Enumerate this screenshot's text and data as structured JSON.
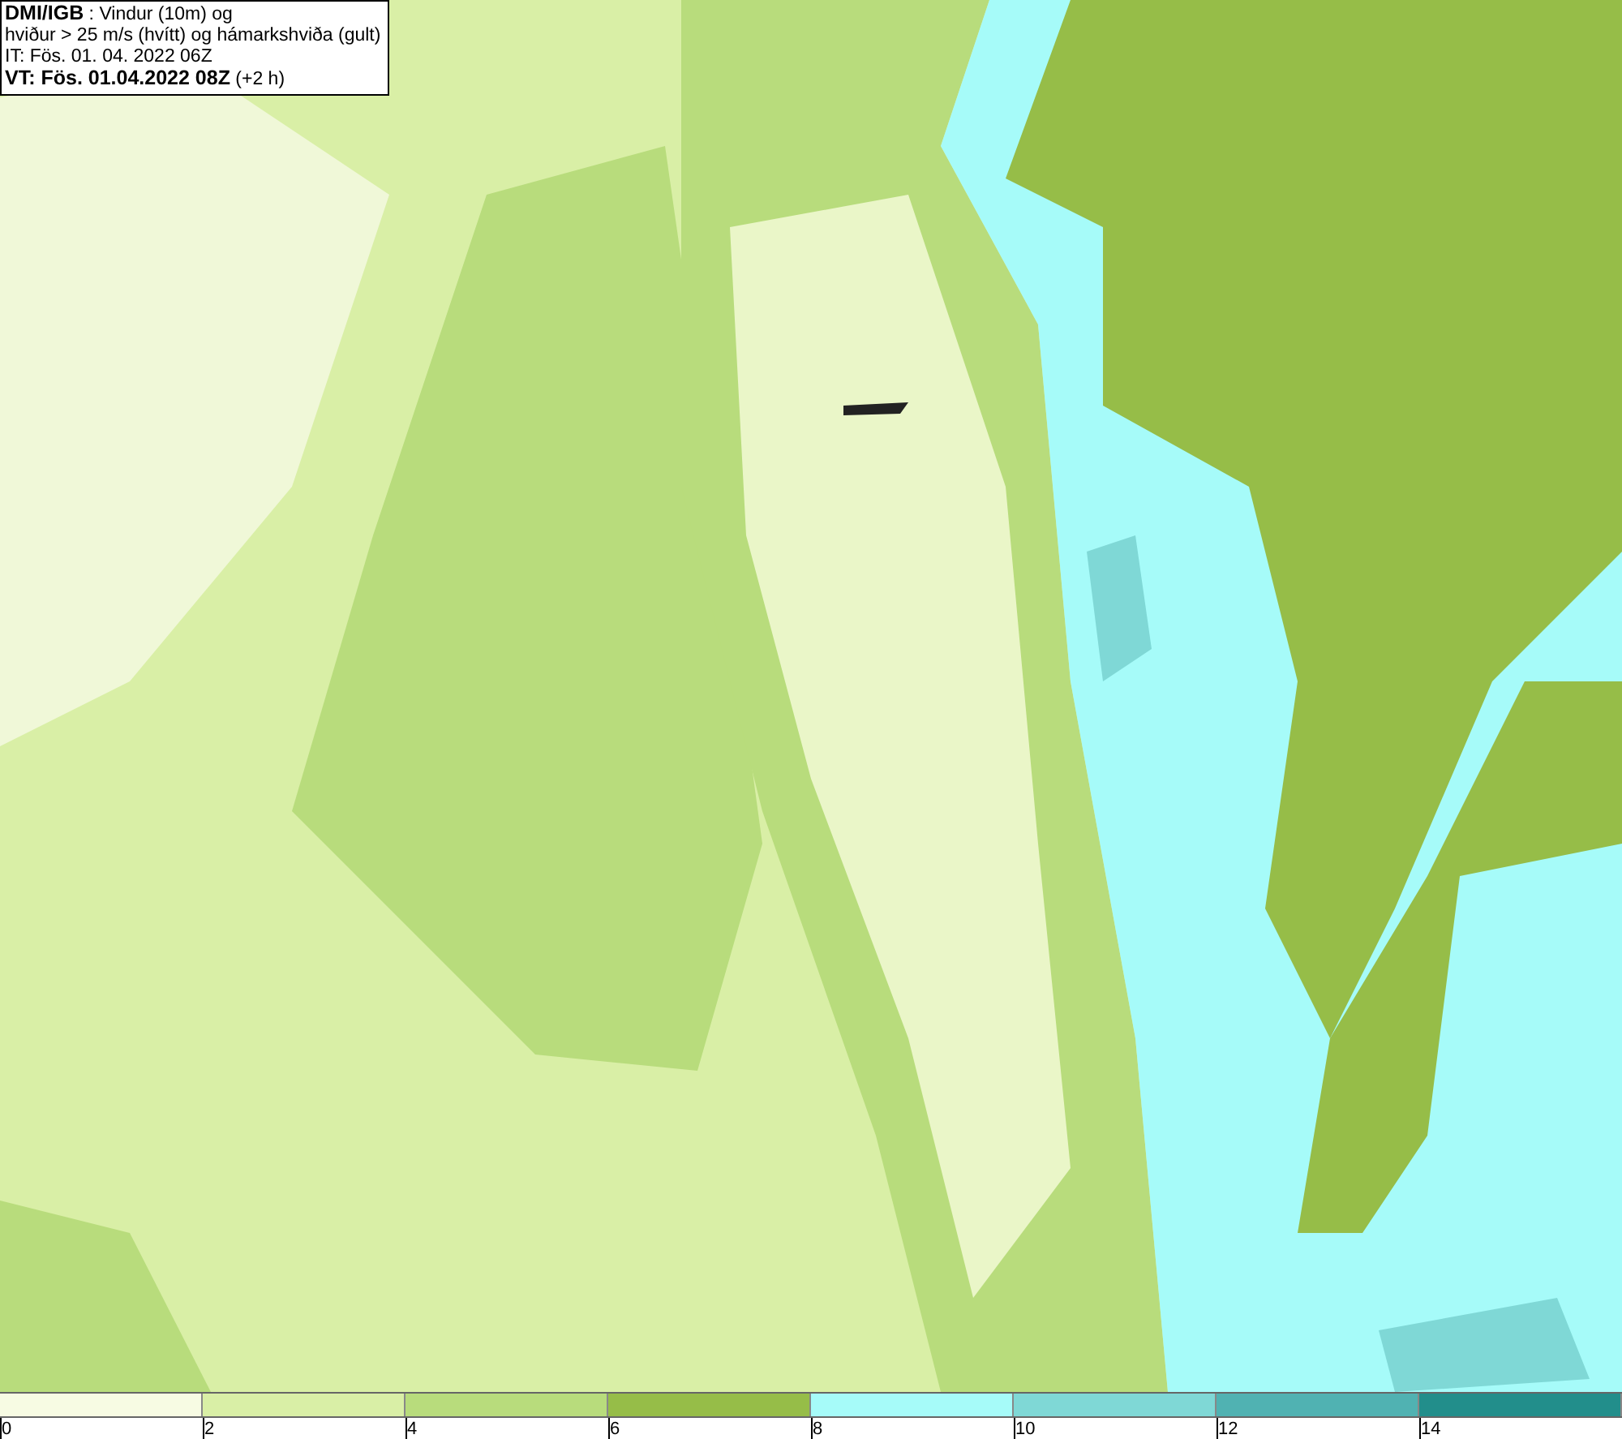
{
  "title_box": {
    "lines": [
      "**DMI/IGB** : Vindur (10m) og",
      "hviður > 25 m/s (hvítt) og hámarkshviða (gult)",
      "IT: Fös. 01. 04. 2022 06Z",
      "**VT: Fös. 01.04.2022 08Z** (+2 h)"
    ]
  },
  "legend": {
    "segments": [
      {
        "color": "#f7fbe3"
      },
      {
        "color": "#d9efa6"
      },
      {
        "color": "#b8dc7c"
      },
      {
        "color": "#96bd48"
      },
      {
        "color": "#a6fbf9"
      },
      {
        "color": "#7fd8d6"
      },
      {
        "color": "#50b2b2"
      },
      {
        "color": "#228e8b"
      }
    ],
    "ticks": [
      "0",
      "2",
      "4",
      "6",
      "8",
      "10",
      "12",
      "14"
    ]
  }
}
